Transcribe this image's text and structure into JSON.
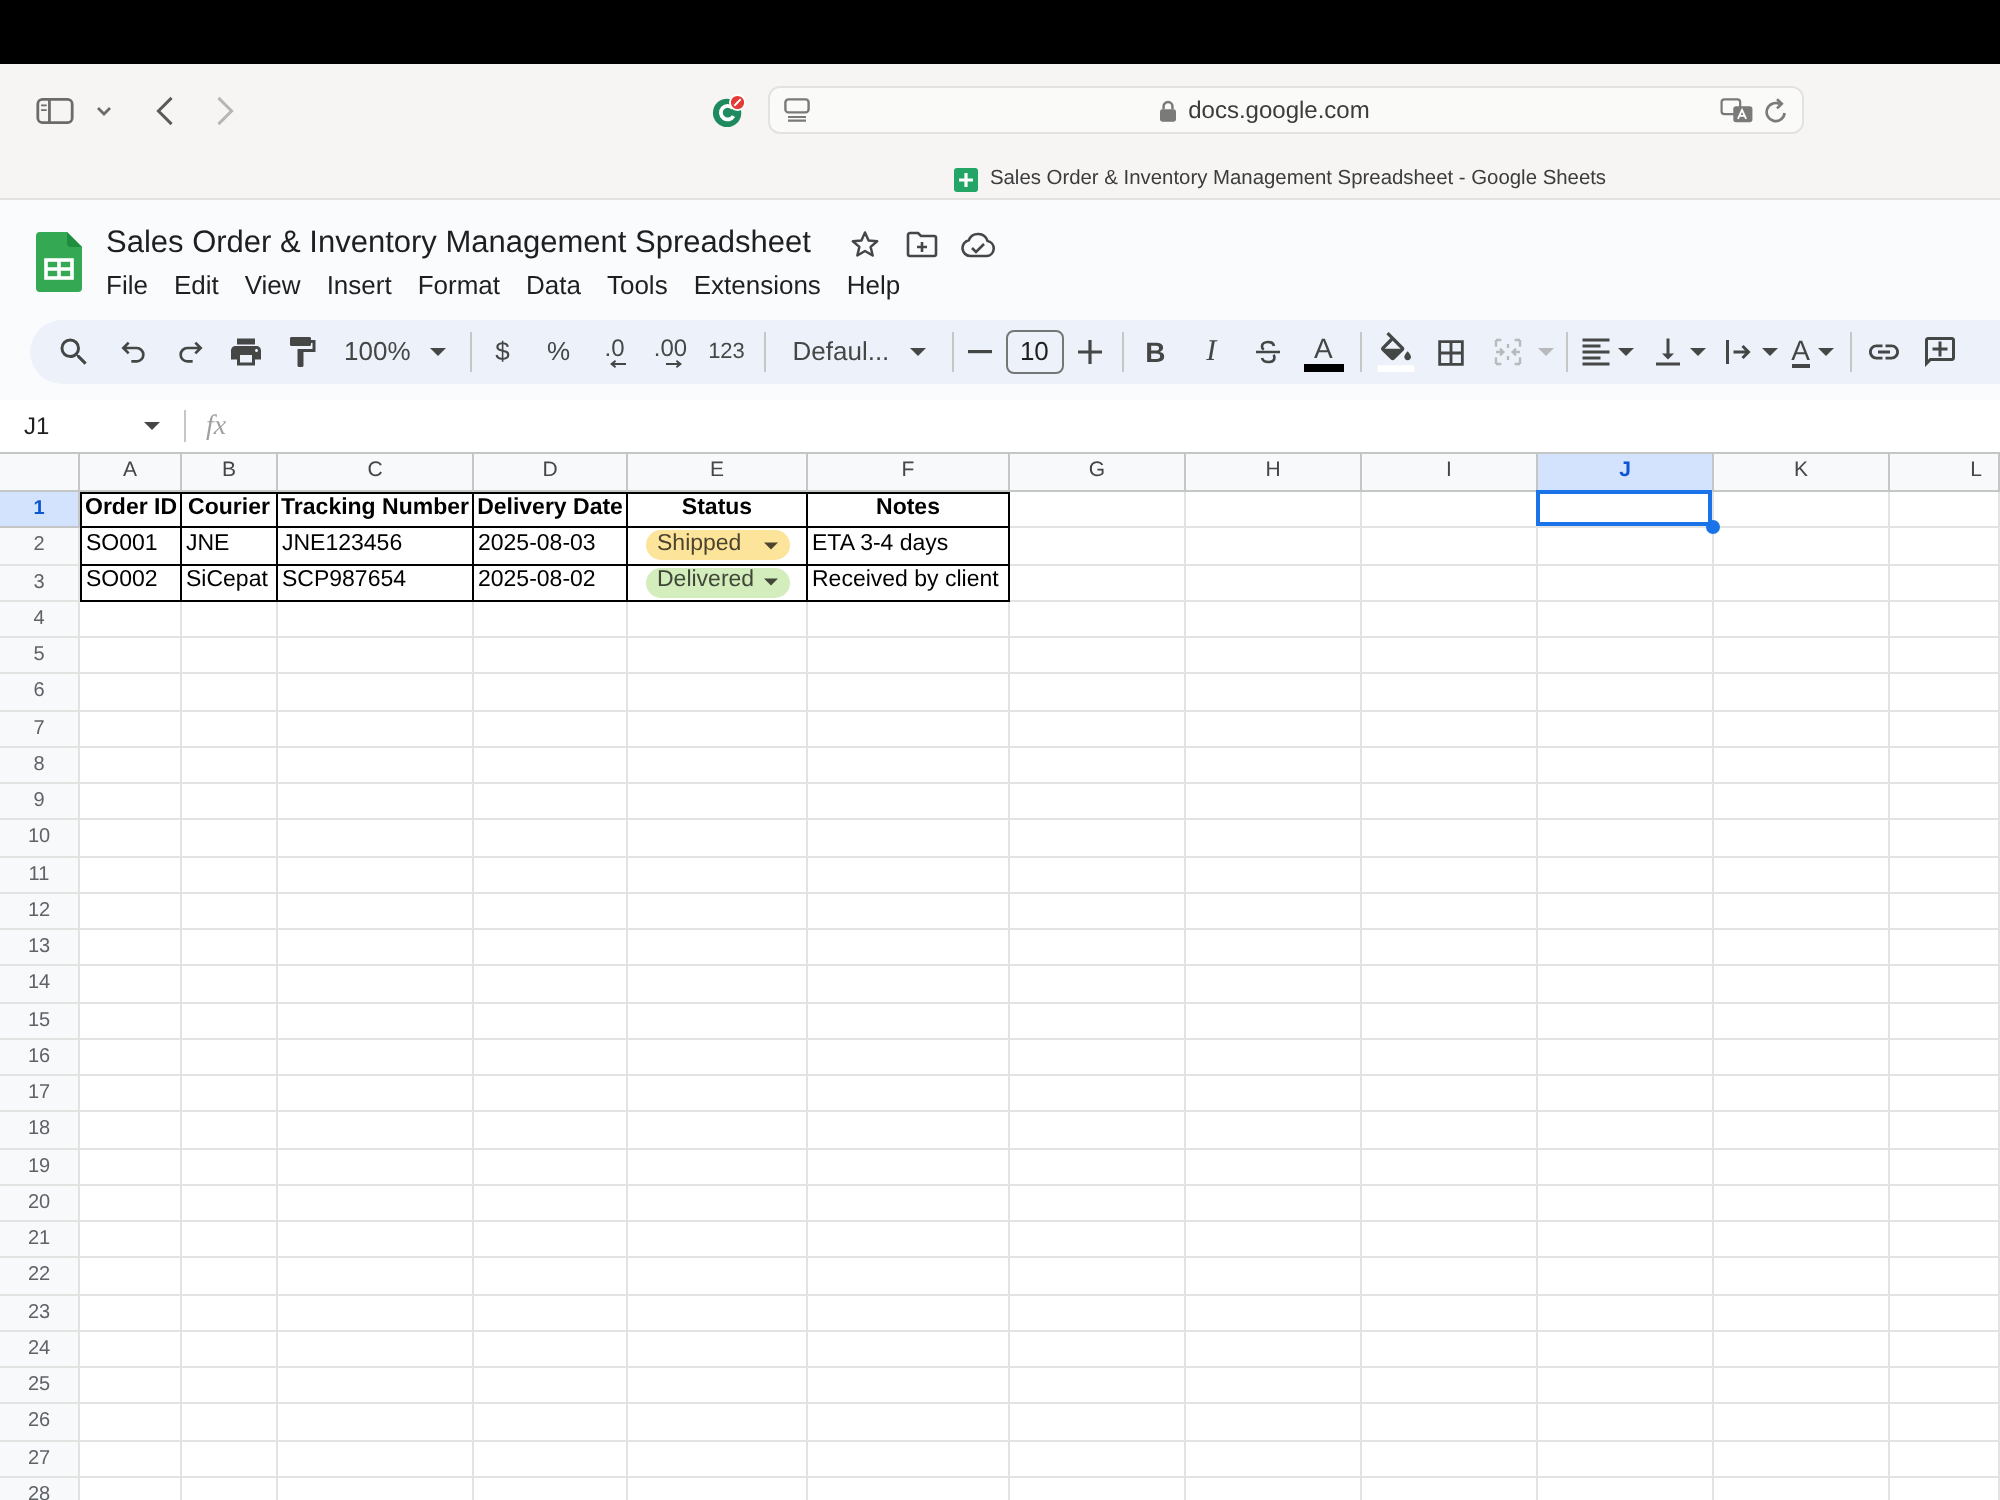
{
  "browser": {
    "url": "docs.google.com",
    "tab_title": "Sales Order & Inventory Management Spreadsheet - Google Sheets"
  },
  "document": {
    "title": "Sales Order & Inventory Management Spreadsheet",
    "menu": [
      "File",
      "Edit",
      "View",
      "Insert",
      "Format",
      "Data",
      "Tools",
      "Extensions",
      "Help"
    ]
  },
  "toolbar": {
    "zoom": "100%",
    "currency": "$",
    "percent": "%",
    "decrease_decimal": ".0",
    "increase_decimal": ".00",
    "more_formats": "123",
    "font": "Defaul...",
    "font_size": "10",
    "bold": "B",
    "italic": "I",
    "text_color": "A",
    "text_rotation": "A"
  },
  "formula_bar": {
    "cell_reference": "J1",
    "function_label": "fx"
  },
  "sheet": {
    "columns": [
      {
        "label": "A",
        "selected": false
      },
      {
        "label": "B",
        "selected": false
      },
      {
        "label": "C",
        "selected": false
      },
      {
        "label": "D",
        "selected": false
      },
      {
        "label": "E",
        "selected": false
      },
      {
        "label": "F",
        "selected": false
      },
      {
        "label": "G",
        "selected": false
      },
      {
        "label": "H",
        "selected": false
      },
      {
        "label": "I",
        "selected": false
      },
      {
        "label": "J",
        "selected": true
      },
      {
        "label": "K",
        "selected": false
      },
      {
        "label": "L",
        "selected": false
      }
    ],
    "rows": [
      {
        "number": "1",
        "selected": true,
        "kind": "header",
        "cells": [
          {
            "kind": "text",
            "text": "Order ID"
          },
          {
            "kind": "text",
            "text": "Courier"
          },
          {
            "kind": "text",
            "text": "Tracking Number"
          },
          {
            "kind": "text",
            "text": "Delivery Date"
          },
          {
            "kind": "text",
            "text": "Status"
          },
          {
            "kind": "text",
            "text": "Notes"
          }
        ]
      },
      {
        "number": "2",
        "selected": false,
        "kind": "data",
        "cells": [
          {
            "kind": "text",
            "text": "SO001"
          },
          {
            "kind": "text",
            "text": "JNE"
          },
          {
            "kind": "text",
            "text": "JNE123456"
          },
          {
            "kind": "text",
            "text": "2025-08-03"
          },
          {
            "kind": "chip",
            "text": "Shipped",
            "color": "#fde49b"
          },
          {
            "kind": "text",
            "text": "ETA 3-4 days"
          }
        ]
      },
      {
        "number": "3",
        "selected": false,
        "kind": "data",
        "cells": [
          {
            "kind": "text",
            "text": "SO002"
          },
          {
            "kind": "text",
            "text": "SiCepat"
          },
          {
            "kind": "text",
            "text": "SCP987654"
          },
          {
            "kind": "text",
            "text": "2025-08-02"
          },
          {
            "kind": "chip",
            "text": "Delivered",
            "color": "#d4edbc"
          },
          {
            "kind": "text",
            "text": "Received by client"
          }
        ]
      },
      {
        "number": "4",
        "selected": false
      },
      {
        "number": "5",
        "selected": false
      },
      {
        "number": "6",
        "selected": false
      },
      {
        "number": "7",
        "selected": false
      },
      {
        "number": "8",
        "selected": false
      },
      {
        "number": "9",
        "selected": false
      },
      {
        "number": "10",
        "selected": false
      },
      {
        "number": "11",
        "selected": false
      },
      {
        "number": "12",
        "selected": false
      },
      {
        "number": "13",
        "selected": false
      },
      {
        "number": "14",
        "selected": false
      },
      {
        "number": "15",
        "selected": false
      },
      {
        "number": "16",
        "selected": false
      },
      {
        "number": "17",
        "selected": false
      },
      {
        "number": "18",
        "selected": false
      },
      {
        "number": "19",
        "selected": false
      },
      {
        "number": "20",
        "selected": false
      },
      {
        "number": "21",
        "selected": false
      },
      {
        "number": "22",
        "selected": false
      },
      {
        "number": "23",
        "selected": false
      },
      {
        "number": "24",
        "selected": false
      },
      {
        "number": "25",
        "selected": false
      },
      {
        "number": "26",
        "selected": false
      },
      {
        "number": "27",
        "selected": false
      },
      {
        "number": "28",
        "selected": false
      }
    ]
  }
}
